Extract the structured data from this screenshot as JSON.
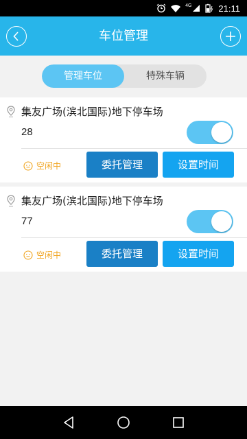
{
  "statusbar": {
    "time": "21:11",
    "network_label": "4G",
    "icons": [
      "alarm-icon",
      "wifi-icon",
      "signal-icon",
      "battery-icon"
    ]
  },
  "header": {
    "title": "车位管理",
    "back_icon": "chevron-left-icon",
    "add_icon": "plus-icon"
  },
  "tabs": [
    {
      "label": "管理车位",
      "active": true
    },
    {
      "label": "特殊车辆",
      "active": false
    }
  ],
  "spots": [
    {
      "name": "集友广场(滨北国际)地下停车场",
      "number": "28",
      "status": "空闲中",
      "toggle_on": true,
      "delegate_label": "委托管理",
      "set_time_label": "设置时间"
    },
    {
      "name": "集友广场(滨北国际)地下停车场",
      "number": "77",
      "status": "空闲中",
      "toggle_on": true,
      "delegate_label": "委托管理",
      "set_time_label": "设置时间"
    }
  ],
  "colors": {
    "accent": "#28b5ea",
    "toggle": "#5cc5f3",
    "delegate_button": "#1a80c6",
    "set_time_button": "#14a4f0",
    "status": "#f0a31c"
  },
  "navbar": {
    "icons": [
      "back-triangle-icon",
      "home-circle-icon",
      "recents-square-icon"
    ]
  }
}
